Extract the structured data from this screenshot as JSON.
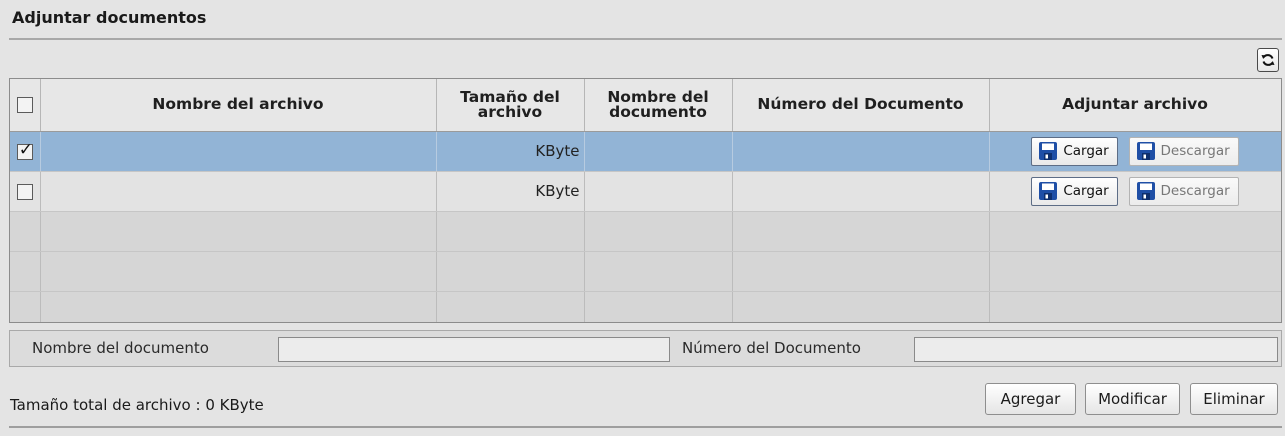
{
  "panel": {
    "title": "Adjuntar documentos"
  },
  "grid": {
    "columns": [
      "Nombre del archivo",
      "Tamaño del archivo",
      "Nombre del documento",
      "Número del Documento",
      "Adjuntar archivo"
    ],
    "rows": [
      {
        "checked": true,
        "selected": true,
        "nombre_archivo": "",
        "tamano": "KByte",
        "nombre_documento": "",
        "numero_documento": "",
        "cargar": "Cargar",
        "descargar": "Descargar"
      },
      {
        "checked": false,
        "selected": false,
        "nombre_archivo": "",
        "tamano": "KByte",
        "nombre_documento": "",
        "numero_documento": "",
        "cargar": "Cargar",
        "descargar": "Descargar"
      }
    ]
  },
  "form": {
    "nombre_label": "Nombre del documento",
    "nombre_value": "",
    "numero_label": "Número del Documento",
    "numero_value": ""
  },
  "footer": {
    "total_label": "Tamaño total de archivo :",
    "total_value": "0 KByte",
    "agregar": "Agregar",
    "modificar": "Modificar",
    "eliminar": "Eliminar"
  },
  "icons": {
    "refresh": "refresh-icon",
    "save": "floppy-disk-icon"
  },
  "colors": {
    "selected_row": "#92b4d6",
    "floppy": "#1f4fa6"
  }
}
